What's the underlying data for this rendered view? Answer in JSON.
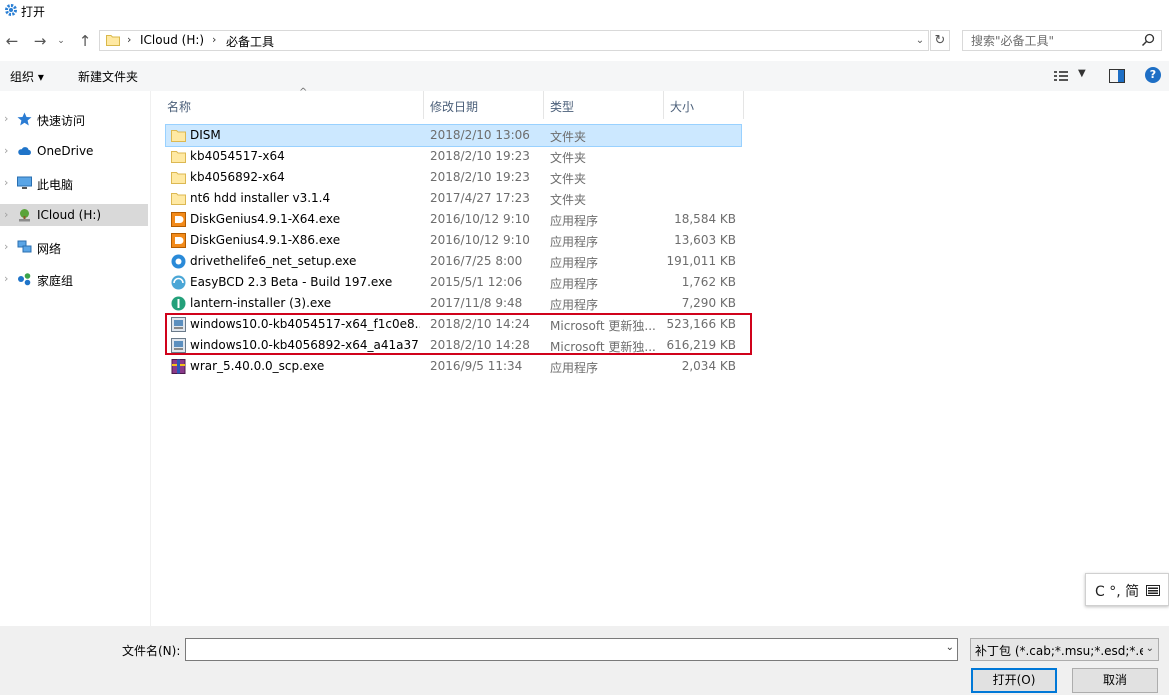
{
  "window": {
    "title": "打开"
  },
  "address": {
    "crumbs": [
      "ICloud (H:)",
      "必备工具"
    ]
  },
  "search": {
    "placeholder": "搜索\"必备工具\""
  },
  "toolbar": {
    "organize": "组织 ▾",
    "new_folder": "新建文件夹"
  },
  "nav": {
    "items": [
      {
        "label": "快速访问",
        "icon": "star-icon"
      },
      {
        "label": "OneDrive",
        "icon": "cloud-icon"
      },
      {
        "label": "此电脑",
        "icon": "computer-icon"
      },
      {
        "label": "ICloud (H:)",
        "icon": "drive-icon",
        "selected": true
      },
      {
        "label": "网络",
        "icon": "network-icon"
      },
      {
        "label": "家庭组",
        "icon": "homegroup-icon"
      }
    ]
  },
  "columns": {
    "name": "名称",
    "date": "修改日期",
    "type": "类型",
    "size": "大小"
  },
  "files": [
    {
      "name": "DISM",
      "date": "2018/2/10 13:06",
      "type": "文件夹",
      "size": "",
      "icon": "folder-icon",
      "selected": true
    },
    {
      "name": "kb4054517-x64",
      "date": "2018/2/10 19:23",
      "type": "文件夹",
      "size": "",
      "icon": "folder-icon"
    },
    {
      "name": "kb4056892-x64",
      "date": "2018/2/10 19:23",
      "type": "文件夹",
      "size": "",
      "icon": "folder-icon"
    },
    {
      "name": "nt6 hdd installer v3.1.4",
      "date": "2017/4/27 17:23",
      "type": "文件夹",
      "size": "",
      "icon": "folder-icon"
    },
    {
      "name": "DiskGenius4.9.1-X64.exe",
      "date": "2016/10/12 9:10",
      "type": "应用程序",
      "size": "18,584 KB",
      "icon": "diskgenius-icon"
    },
    {
      "name": "DiskGenius4.9.1-X86.exe",
      "date": "2016/10/12 9:10",
      "type": "应用程序",
      "size": "13,603 KB",
      "icon": "diskgenius-icon"
    },
    {
      "name": "drivethelife6_net_setup.exe",
      "date": "2016/7/25 8:00",
      "type": "应用程序",
      "size": "191,011 KB",
      "icon": "drivethelife-icon"
    },
    {
      "name": "EasyBCD 2.3 Beta - Build 197.exe",
      "date": "2015/5/1 12:06",
      "type": "应用程序",
      "size": "1,762 KB",
      "icon": "easybcd-icon"
    },
    {
      "name": "lantern-installer (3).exe",
      "date": "2017/11/8 9:48",
      "type": "应用程序",
      "size": "7,290 KB",
      "icon": "lantern-icon"
    },
    {
      "name": "windows10.0-kb4054517-x64_f1c0e8...",
      "date": "2018/2/10 14:24",
      "type": "Microsoft 更新独...",
      "size": "523,166 KB",
      "icon": "msu-icon"
    },
    {
      "name": "windows10.0-kb4056892-x64_a41a37...",
      "date": "2018/2/10 14:28",
      "type": "Microsoft 更新独...",
      "size": "616,219 KB",
      "icon": "msu-icon"
    },
    {
      "name": "wrar_5.40.0.0_scp.exe",
      "date": "2016/9/5 11:34",
      "type": "应用程序",
      "size": "2,034 KB",
      "icon": "winrar-icon"
    }
  ],
  "ime": {
    "text": "C °, 简"
  },
  "bottom": {
    "filename_label": "文件名(N):",
    "filename_value": "",
    "filter": "补丁包 (*.cab;*.msu;*.esd;*.exe)",
    "open": "打开(O)",
    "cancel": "取消"
  },
  "colors": {
    "selection": "#cce8ff",
    "highlight_box": "#d0021b",
    "accent": "#0078d7"
  }
}
